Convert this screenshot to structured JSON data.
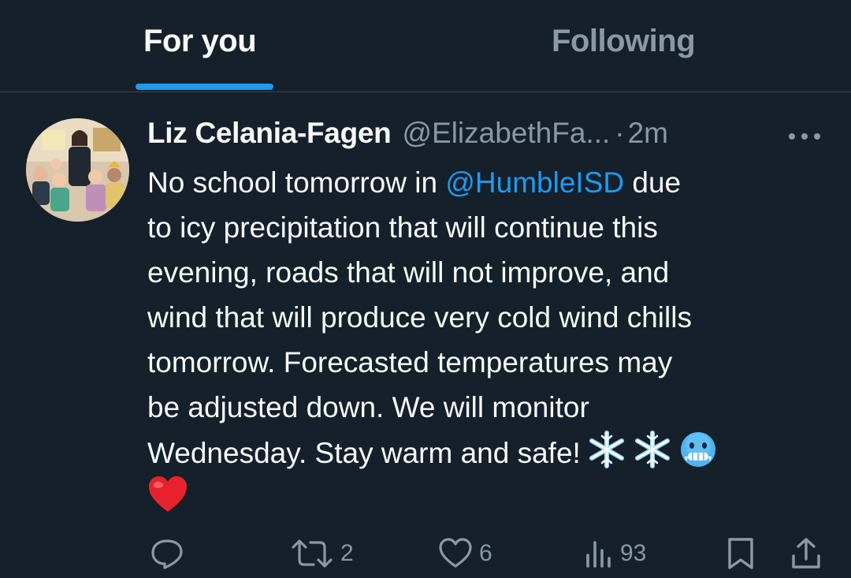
{
  "tabs": {
    "for_you": "For you",
    "following": "Following",
    "active": "For you"
  },
  "tweet": {
    "author_name": "Liz Celania-Fagen",
    "author_handle": "@ElizabethFa...",
    "separator": "·",
    "time": "2m",
    "body_lines": [
      {
        "before": "No school tomorrow in ",
        "mention": "@HumbleISD",
        "after": " due"
      },
      {
        "text": "to icy precipitation that will continue this"
      },
      {
        "text": "evening, roads that will not improve, and"
      },
      {
        "text": "wind that will produce very cold wind chills"
      },
      {
        "text": "tomorrow. Forecasted temperatures may"
      },
      {
        "text": "be adjusted down. We will monitor"
      },
      {
        "text": "Wednesday. Stay warm and safe!"
      }
    ],
    "emojis": [
      "snowflake",
      "snowflake",
      "cold-face",
      "red-heart"
    ]
  },
  "actions": {
    "reply_count": "",
    "retweet_count": "2",
    "like_count": "6",
    "views_count": "93"
  },
  "colors": {
    "background": "#15202b",
    "accent": "#1d9bf0",
    "muted": "#8b98a5",
    "text": "#f7f9f9",
    "divider": "#38444d"
  }
}
